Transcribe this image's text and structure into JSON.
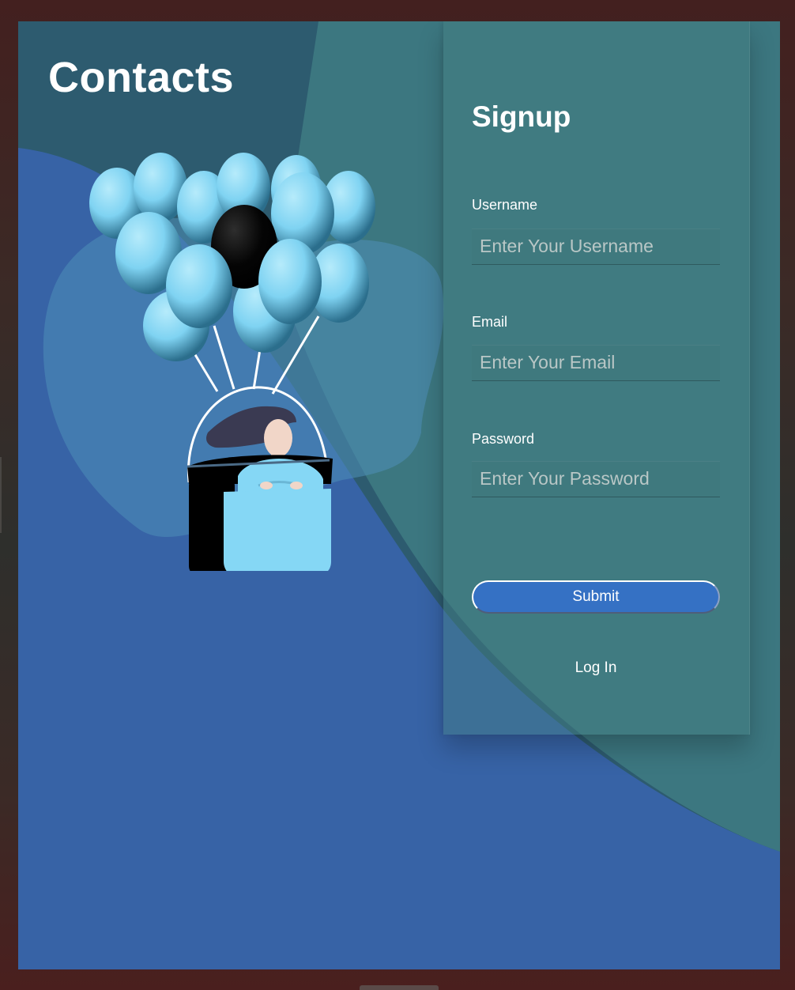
{
  "app": {
    "title": "Contacts"
  },
  "signup": {
    "title": "Signup",
    "username": {
      "label": "Username",
      "placeholder": "Enter Your Username",
      "value": ""
    },
    "email": {
      "label": "Email",
      "placeholder": "Enter Your Email",
      "value": ""
    },
    "password": {
      "label": "Password",
      "placeholder": "Enter Your Password",
      "value": ""
    },
    "submit_label": "Submit",
    "login_label": "Log In"
  },
  "colors": {
    "background": "#3763a6",
    "teal_region": "#43878a",
    "card": "#40797e",
    "button": "#3571c4",
    "balloon_light": "#85d7f5",
    "balloon_dark": "#000000"
  },
  "illustration": {
    "name": "woman-in-balloon-basket"
  }
}
